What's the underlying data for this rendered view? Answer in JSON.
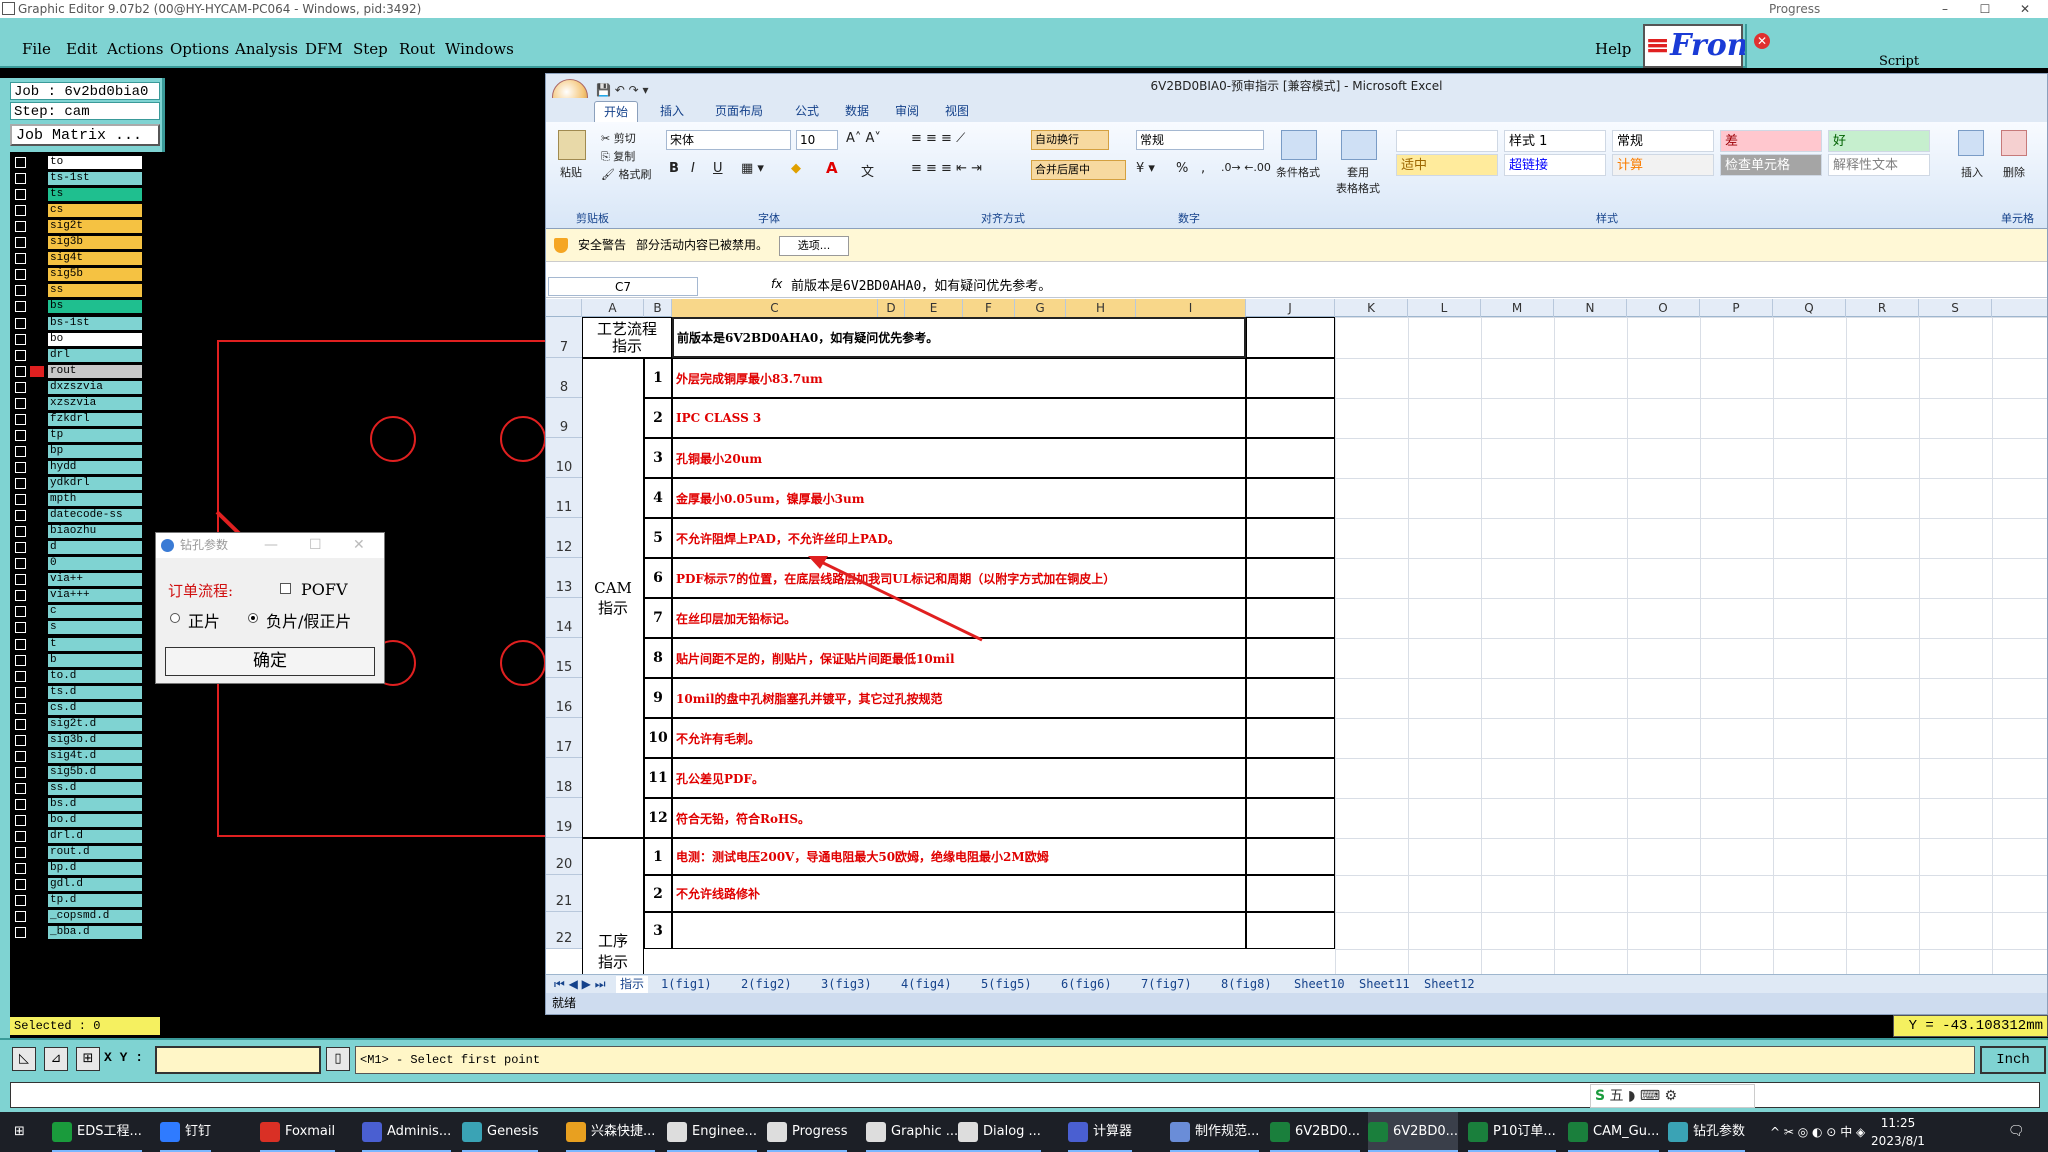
{
  "ge_window": {
    "title": "Graphic Editor 9.07b2 (00@HY-HYCAM-PC064 - Windows, pid:3492)"
  },
  "progress_window": {
    "title": "Progress",
    "script_label": "Script",
    "min": "–",
    "max": "☐",
    "close": "✕"
  },
  "menu": {
    "items": [
      "File",
      "Edit",
      "Actions",
      "Options",
      "Analysis",
      "DFM",
      "Step",
      "Rout",
      "Windows"
    ],
    "help": "Help",
    "logo_f": "≡",
    "logo_text": "Fron"
  },
  "job": {
    "job_line": "Job : 6v2bd0bia0",
    "step_line": "Step: cam",
    "matrix_btn": "Job Matrix ..."
  },
  "layers": [
    {
      "name": "to",
      "color": "#ffffff"
    },
    {
      "name": "ts-1st",
      "color": "#7fd3d2"
    },
    {
      "name": "ts",
      "color": "#1fbf8f"
    },
    {
      "name": "cs",
      "color": "#f5c242"
    },
    {
      "name": "sig2t",
      "color": "#f5c242"
    },
    {
      "name": "sig3b",
      "color": "#f5c242"
    },
    {
      "name": "sig4t",
      "color": "#f5c242"
    },
    {
      "name": "sig5b",
      "color": "#f5c242"
    },
    {
      "name": "ss",
      "color": "#f5c242"
    },
    {
      "name": "bs",
      "color": "#1fbf8f"
    },
    {
      "name": "bs-1st",
      "color": "#7fd3d2"
    },
    {
      "name": "bo",
      "color": "#ffffff"
    },
    {
      "name": "drl",
      "color": "#7fd3d2"
    },
    {
      "name": "rout",
      "color": "#c8c8c8"
    },
    {
      "name": "dxzszvia",
      "color": "#7fd3d2"
    },
    {
      "name": "xzszvia",
      "color": "#7fd3d2"
    },
    {
      "name": "fzkdrl",
      "color": "#7fd3d2"
    },
    {
      "name": "tp",
      "color": "#7fd3d2"
    },
    {
      "name": "bp",
      "color": "#7fd3d2"
    },
    {
      "name": "hydd",
      "color": "#7fd3d2"
    },
    {
      "name": "ydkdrl",
      "color": "#7fd3d2"
    },
    {
      "name": "mpth",
      "color": "#7fd3d2"
    },
    {
      "name": "datecode-ss",
      "color": "#7fd3d2"
    },
    {
      "name": "biaozhu",
      "color": "#7fd3d2"
    },
    {
      "name": "d",
      "color": "#7fd3d2"
    },
    {
      "name": "0",
      "color": "#7fd3d2"
    },
    {
      "name": "via++",
      "color": "#7fd3d2"
    },
    {
      "name": "via+++",
      "color": "#7fd3d2"
    },
    {
      "name": "c",
      "color": "#7fd3d2"
    },
    {
      "name": "s",
      "color": "#7fd3d2"
    },
    {
      "name": "t",
      "color": "#7fd3d2"
    },
    {
      "name": "b",
      "color": "#7fd3d2"
    },
    {
      "name": "to.d",
      "color": "#7fd3d2"
    },
    {
      "name": "ts.d",
      "color": "#7fd3d2"
    },
    {
      "name": "cs.d",
      "color": "#7fd3d2"
    },
    {
      "name": "sig2t.d",
      "color": "#7fd3d2"
    },
    {
      "name": "sig3b.d",
      "color": "#7fd3d2"
    },
    {
      "name": "sig4t.d",
      "color": "#7fd3d2"
    },
    {
      "name": "sig5b.d",
      "color": "#7fd3d2"
    },
    {
      "name": "ss.d",
      "color": "#7fd3d2"
    },
    {
      "name": "bs.d",
      "color": "#7fd3d2"
    },
    {
      "name": "bo.d",
      "color": "#7fd3d2"
    },
    {
      "name": "drl.d",
      "color": "#7fd3d2"
    },
    {
      "name": "rout.d",
      "color": "#7fd3d2"
    },
    {
      "name": "bp.d",
      "color": "#7fd3d2"
    },
    {
      "name": "gdl.d",
      "color": "#7fd3d2"
    },
    {
      "name": "tp.d",
      "color": "#7fd3d2"
    },
    {
      "name": "_copsmd.d",
      "color": "#7fd3d2"
    },
    {
      "name": "_bba.d",
      "color": "#7fd3d2"
    }
  ],
  "selected_text": "Selected : 0",
  "drill_dialog": {
    "title": "钻孔参数",
    "order_flow_label": "订单流程:",
    "pofv_label": "POFV",
    "pofv_checked": false,
    "radio_positive": "正片",
    "radio_negative": "负片/假正片",
    "selected_radio": "负片/假正片",
    "ok_button": "确定"
  },
  "excel": {
    "title": "6V2BD0BIA0-预审指示 [兼容模式] - Microsoft Excel",
    "tabs": [
      "开始",
      "插入",
      "页面布局",
      "公式",
      "数据",
      "审阅",
      "视图"
    ],
    "active_tab": "开始",
    "clipboard": {
      "paste": "粘贴",
      "cut": "剪切",
      "copy": "复制",
      "format_painter": "格式刷",
      "group": "剪贴板"
    },
    "font": {
      "name": "宋体",
      "size": "10",
      "bold": "B",
      "italic": "I",
      "underline": "U",
      "group": "字体"
    },
    "align": {
      "wrap": "自动换行",
      "merge": "合并后居中",
      "group": "对齐方式"
    },
    "number": {
      "format": "常规",
      "group": "数字",
      "pct": "%",
      "comma": ","
    },
    "styles": {
      "cond_format": "条件格式",
      "table_format": "套用\n表格格式",
      "cells": [
        {
          "label": "",
          "bg": "#ffffff",
          "color": "#000"
        },
        {
          "label": "样式 1",
          "bg": "#ffffff",
          "color": "#000"
        },
        {
          "label": "常规",
          "bg": "#ffffff",
          "color": "#000"
        },
        {
          "label": "差",
          "bg": "#ffc7ce",
          "color": "#9c0006"
        },
        {
          "label": "好",
          "bg": "#c6efce",
          "color": "#006100"
        },
        {
          "label": "适中",
          "bg": "#ffeb9c",
          "color": "#9c6500"
        },
        {
          "label": "超链接",
          "bg": "#ffffff",
          "color": "#0000ff"
        },
        {
          "label": "计算",
          "bg": "#f2f2f2",
          "color": "#fa7d00"
        },
        {
          "label": "检查单元格",
          "bg": "#a5a5a5",
          "color": "#ffffff"
        },
        {
          "label": "解释性文本",
          "bg": "#ffffff",
          "color": "#7f7f7f"
        }
      ],
      "group": "样式"
    },
    "cellsgrp": {
      "insert": "插入",
      "delete": "删除",
      "group": "单元格"
    },
    "security": {
      "label": "安全警告",
      "msg": "部分活动内容已被禁用。",
      "options": "选项..."
    },
    "namebox": "C7",
    "formula": "前版本是6V2BD0AHA0，如有疑问优先参考。",
    "columns": [
      "A",
      "B",
      "C",
      "D",
      "E",
      "F",
      "G",
      "H",
      "I",
      "J",
      "K",
      "L",
      "M",
      "N",
      "O",
      "P",
      "Q",
      "R",
      "S"
    ],
    "rows": [
      "7",
      "8",
      "9",
      "10",
      "11",
      "12",
      "13",
      "14",
      "15",
      "16",
      "17",
      "18",
      "19",
      "20",
      "21",
      "22"
    ],
    "a7": "工艺流程\n指示",
    "c7": "前版本是6V2BD0AHA0，如有疑问优先参考。",
    "cam_label": "CAM\n指示",
    "process_label": "工序\n指示",
    "cam_items": [
      {
        "n": "1",
        "t": "外层完成铜厚最小83.7um"
      },
      {
        "n": "2",
        "t": "IPC CLASS 3"
      },
      {
        "n": "3",
        "t": "孔铜最小20um"
      },
      {
        "n": "4",
        "t": "金厚最小0.05um，镍厚最小3um"
      },
      {
        "n": "5",
        "t": "不允许阻焊上PAD，不允许丝印上PAD。"
      },
      {
        "n": "6",
        "t": "PDF标示7的位置，在底层线路层加我司UL标记和周期（以附字方式加在铜皮上）"
      },
      {
        "n": "7",
        "t": "在丝印层加无铅标记。"
      },
      {
        "n": "8",
        "t": "贴片间距不足的，削贴片，保证贴片间距最低10mil"
      },
      {
        "n": "9",
        "t": "10mil的盘中孔树脂塞孔并镀平，其它过孔按规范"
      },
      {
        "n": "10",
        "t": "不允许有毛刺。"
      },
      {
        "n": "11",
        "t": "孔公差见PDF。"
      },
      {
        "n": "12",
        "t": "符合无铅，符合RoHS。"
      }
    ],
    "proc_items": [
      {
        "n": "1",
        "t": "电测：测试电压200V，导通电阻最大50欧姆，绝缘电阻最小2M欧姆"
      },
      {
        "n": "2",
        "t": "不允许线路修补"
      },
      {
        "n": "3",
        "t": ""
      }
    ],
    "sheets": [
      "指示",
      "1(fig1)",
      "2(fig2)",
      "3(fig3)",
      "4(fig4)",
      "5(fig5)",
      "6(fig6)",
      "7(fig7)",
      "8(fig8)",
      "Sheet10",
      "Sheet11",
      "Sheet12"
    ],
    "status": "就绪"
  },
  "coord": "Y = -43.108312mm",
  "cmd": {
    "xy_label": "X Y :",
    "prompt": "<M1> - Select first point",
    "unit": "Inch"
  },
  "ime": "五",
  "taskbar": {
    "items": [
      {
        "label": "EDS工程...",
        "color": "#1a9b3c"
      },
      {
        "label": "钉钉",
        "color": "#2f7bff"
      },
      {
        "label": "Foxmail",
        "color": "#d93025"
      },
      {
        "label": "Adminis...",
        "color": "#4a5fd1"
      },
      {
        "label": "Genesis",
        "color": "#3aa3b5"
      },
      {
        "label": "兴森快捷...",
        "color": "#e8a020"
      },
      {
        "label": "Enginee...",
        "color": "#dddddd"
      },
      {
        "label": "Progress",
        "color": "#dddddd"
      },
      {
        "label": "Graphic ...",
        "color": "#dddddd"
      },
      {
        "label": "Dialog ...",
        "color": "#dddddd"
      },
      {
        "label": "计算器",
        "color": "#4a5fd1"
      },
      {
        "label": "制作规范...",
        "color": "#6a8dd8"
      },
      {
        "label": "6V2BD0...",
        "color": "#1a7f3c"
      },
      {
        "label": "6V2BD0...",
        "color": "#1a7f3c"
      },
      {
        "label": "P10订单...",
        "color": "#1a7f3c"
      },
      {
        "label": "CAM_Gu...",
        "color": "#1a7f3c"
      },
      {
        "label": "钻孔参数",
        "color": "#3aa3b5"
      }
    ],
    "time": "11:25",
    "date": "2023/8/1",
    "tray": "中"
  }
}
